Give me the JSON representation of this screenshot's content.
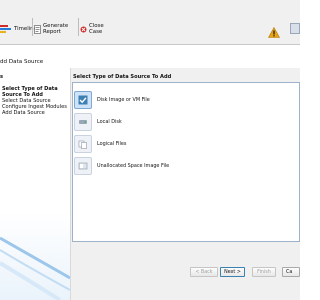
{
  "toolbar": {
    "timeline_label": "Timeline",
    "generate_report_label": "Generate Report",
    "close_case_label": "Close Case"
  },
  "dialog": {
    "title": "dd Data Source",
    "steps_title": "s",
    "steps": [
      "Select Type of Data",
      "Source To Add",
      "Select Data Source",
      "Configure Ingest Modules",
      "Add Data Source"
    ],
    "right_title": "Select Type of Data Source To Add",
    "options": [
      {
        "label": "Disk Image or VM File",
        "selected": true
      },
      {
        "label": "Local Disk",
        "selected": false
      },
      {
        "label": "Logical Files",
        "selected": false
      },
      {
        "label": "Unallocated Space Image File",
        "selected": false
      }
    ],
    "buttons": {
      "back": "< Back",
      "next": "Next >",
      "finish": "Finish",
      "cancel": "Ca"
    }
  },
  "colors": {
    "accent": "#3c7fb1",
    "selected_bg": "#cfe3f8",
    "warning": "#e8a317"
  }
}
